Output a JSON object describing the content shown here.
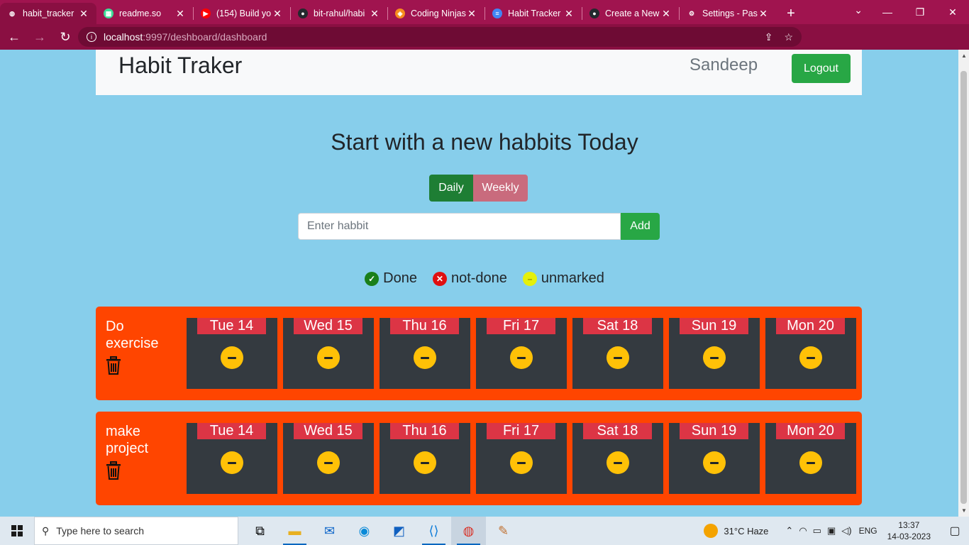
{
  "browser": {
    "tabs": [
      {
        "title": "habit_tracker",
        "favicon": "globe-icon",
        "favicon_color": "#ffffff",
        "active": true
      },
      {
        "title": "readme.so",
        "favicon": "readme-icon",
        "favicon_color": "#3ddc97"
      },
      {
        "title": "(154) Build yo",
        "favicon": "youtube-icon",
        "favicon_color": "#ff0000"
      },
      {
        "title": "bit-rahul/habi",
        "favicon": "github-icon",
        "favicon_color": "#24292e"
      },
      {
        "title": "Coding Ninjas",
        "favicon": "codingninjas-icon",
        "favicon_color": "#f78d1e"
      },
      {
        "title": "Habit Tracker",
        "favicon": "docs-icon",
        "favicon_color": "#4285f4"
      },
      {
        "title": "Create a New",
        "favicon": "github-icon",
        "favicon_color": "#24292e"
      },
      {
        "title": "Settings - Pas",
        "favicon": "gear-icon",
        "favicon_color": "#ffffff"
      }
    ],
    "url_host": "localhost",
    "url_path": ":9997/deshboard/dashboard"
  },
  "navbar": {
    "brand": "Habit Traker",
    "username": "Sandeep",
    "logout_label": "Logout"
  },
  "main": {
    "heading": "Start with a new habbits Today",
    "toggle": {
      "daily_label": "Daily",
      "weekly_label": "Weekly",
      "selected": "Daily"
    },
    "form": {
      "placeholder": "Enter habbit",
      "add_label": "Add"
    },
    "legend": [
      {
        "label": "Done",
        "color": "#1a7f1a",
        "icon": "check-circle-icon"
      },
      {
        "label": "not-done",
        "color": "#e01010",
        "icon": "x-circle-icon"
      },
      {
        "label": "unmarked",
        "color": "#e5f00a",
        "icon": "minus-circle-icon"
      }
    ]
  },
  "habits": [
    {
      "name": "Do exercise",
      "days": [
        {
          "label": "Tue 14",
          "status": "unmarked"
        },
        {
          "label": "Wed 15",
          "status": "unmarked"
        },
        {
          "label": "Thu 16",
          "status": "unmarked"
        },
        {
          "label": "Fri 17",
          "status": "unmarked"
        },
        {
          "label": "Sat 18",
          "status": "unmarked"
        },
        {
          "label": "Sun 19",
          "status": "unmarked"
        },
        {
          "label": "Mon 20",
          "status": "unmarked"
        }
      ]
    },
    {
      "name": "make project",
      "days": [
        {
          "label": "Tue 14",
          "status": "unmarked"
        },
        {
          "label": "Wed 15",
          "status": "unmarked"
        },
        {
          "label": "Thu 16",
          "status": "unmarked"
        },
        {
          "label": "Fri 17",
          "status": "unmarked"
        },
        {
          "label": "Sat 18",
          "status": "unmarked"
        },
        {
          "label": "Sun 19",
          "status": "unmarked"
        },
        {
          "label": "Mon 20",
          "status": "unmarked"
        }
      ]
    }
  ],
  "taskbar": {
    "search_placeholder": "Type here to search",
    "weather": "31°C  Haze",
    "language": "ENG",
    "time": "13:37",
    "date": "14-03-2023"
  },
  "colors": {
    "page_bg": "#87ceeb",
    "habit_card": "#ff4500",
    "day_box": "#343a40",
    "day_label": "#dc3545",
    "unmarked_status": "#ffc107",
    "success": "#28a745"
  }
}
